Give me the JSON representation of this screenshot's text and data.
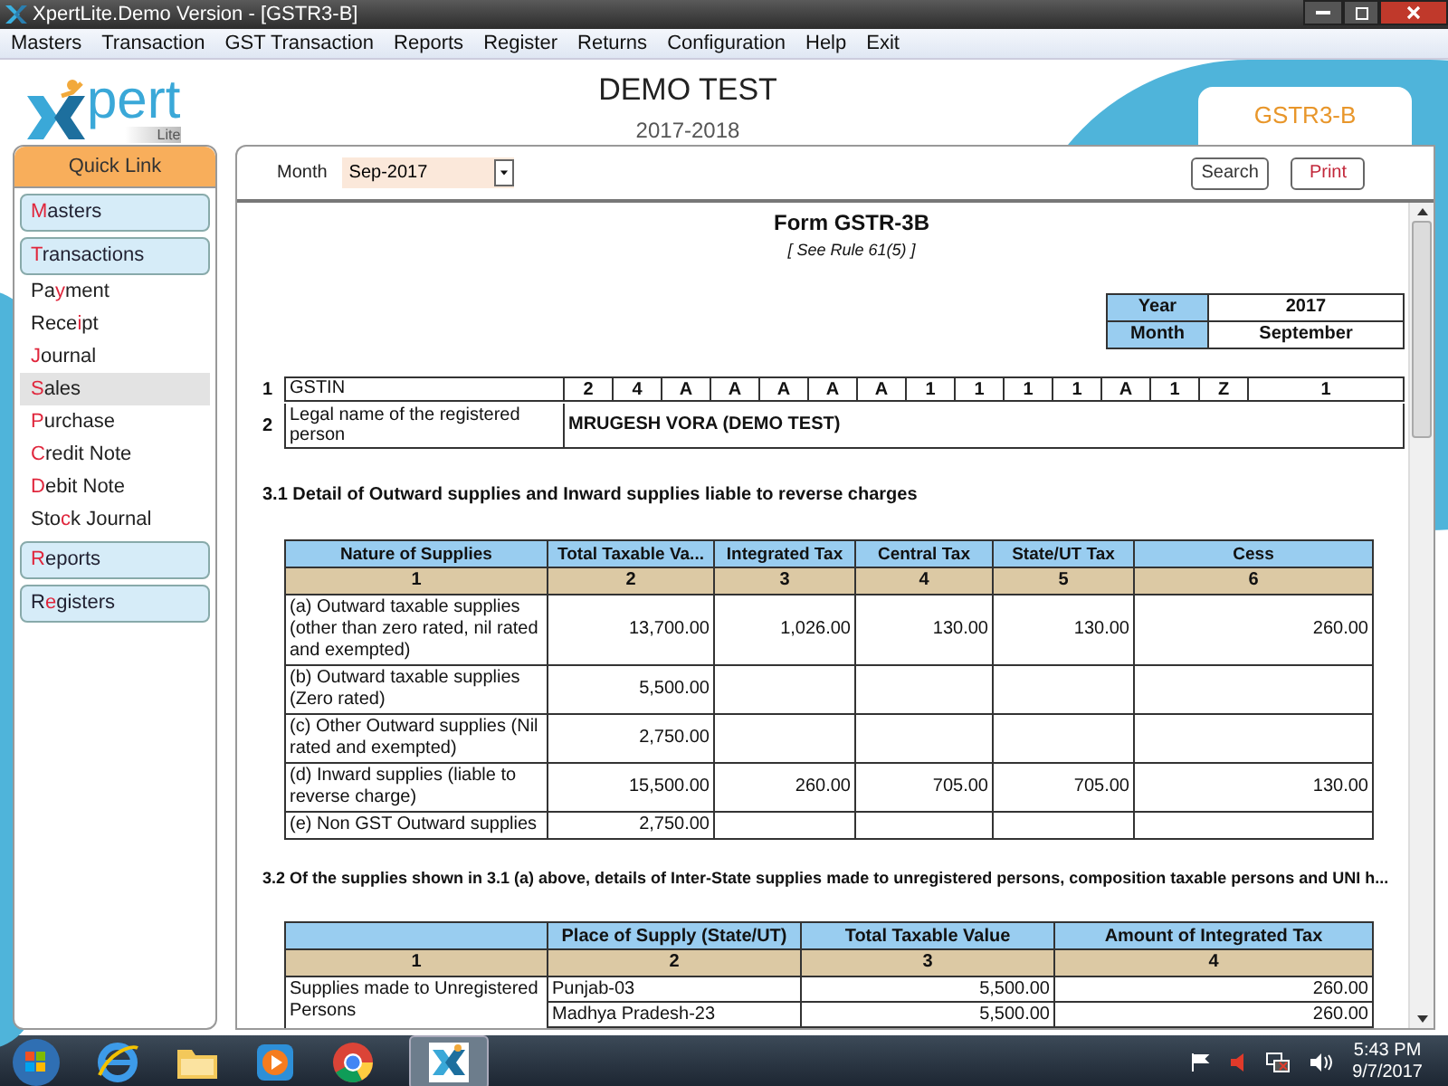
{
  "window": {
    "title": "XpertLite.Demo Version - [GSTR3-B]"
  },
  "menu": [
    "Masters",
    "Transaction",
    "GST Transaction",
    "Reports",
    "Register",
    "Returns",
    "Configuration",
    "Help",
    "Exit"
  ],
  "logo": {
    "wordmark": "pert",
    "tagline": "Lite"
  },
  "header": {
    "company": "DEMO TEST",
    "year": "2017-2018",
    "tab": "GSTR3-B"
  },
  "sidebar": {
    "title": "Quick Link",
    "items": [
      {
        "kind": "section",
        "key": "M",
        "after": "asters",
        "selected": false
      },
      {
        "kind": "section",
        "key": "T",
        "after": "ransactions",
        "selected": false
      },
      {
        "kind": "item",
        "before": "Pa",
        "key": "y",
        "after": "ment",
        "selected": false
      },
      {
        "kind": "item",
        "before": "Rece",
        "key": "i",
        "after": "pt",
        "selected": false
      },
      {
        "kind": "item",
        "key": "J",
        "after": "ournal",
        "selected": false
      },
      {
        "kind": "item",
        "key": "S",
        "after": "ales",
        "selected": true
      },
      {
        "kind": "item",
        "key": "P",
        "after": "urchase",
        "selected": false
      },
      {
        "kind": "item",
        "key": "C",
        "after": "redit Note",
        "selected": false
      },
      {
        "kind": "item",
        "key": "D",
        "after": "ebit Note",
        "selected": false
      },
      {
        "kind": "item",
        "before": "Sto",
        "key": "c",
        "after": "k Journal",
        "selected": false
      },
      {
        "kind": "section",
        "key": "R",
        "after": "eports",
        "selected": false
      },
      {
        "kind": "section",
        "before": "R",
        "key": "e",
        "after": "gisters",
        "selected": false
      }
    ]
  },
  "toolbar": {
    "month_label": "Month",
    "month_value": "Sep-2017",
    "buttons": [
      "Search",
      "Print"
    ]
  },
  "form": {
    "title": "Form GSTR-3B",
    "subtitle": "[ See Rule 61(5) ]",
    "period": [
      {
        "label": "Year",
        "value": "2017"
      },
      {
        "label": "Month",
        "value": "September"
      }
    ],
    "details": [
      {
        "number": "1",
        "label": "GSTIN",
        "cells": [
          "2",
          "4",
          "A",
          "A",
          "A",
          "A",
          "A",
          "1",
          "1",
          "1",
          "1",
          "A",
          "1",
          "Z",
          "1"
        ]
      },
      {
        "number": "2",
        "label": "Legal name of the registered person",
        "value": "MRUGESH VORA (DEMO TEST)"
      }
    ],
    "section_31": {
      "heading": "3.1 Detail of Outward supplies and Inward supplies liable to reverse charges",
      "columns": [
        "Nature of Supplies",
        "Total Taxable Va...",
        "Integrated Tax",
        "Central Tax",
        "State/UT Tax",
        "Cess"
      ],
      "column_numbers": [
        "1",
        "2",
        "3",
        "4",
        "5",
        "6"
      ],
      "rows": [
        [
          "(a) Outward taxable supplies (other than zero rated, nil rated and exempted)",
          "13,700.00",
          "1,026.00",
          "130.00",
          "130.00",
          "260.00"
        ],
        [
          "(b) Outward taxable supplies (Zero rated)",
          "5,500.00",
          "",
          "",
          "",
          ""
        ],
        [
          "(c) Other Outward supplies (Nil rated and exempted)",
          "2,750.00",
          "",
          "",
          "",
          ""
        ],
        [
          "(d) Inward supplies (liable to reverse charge)",
          "15,500.00",
          "260.00",
          "705.00",
          "705.00",
          "130.00"
        ],
        [
          "(e) Non GST Outward supplies",
          "2,750.00",
          "",
          "",
          "",
          ""
        ]
      ]
    },
    "section_32": {
      "heading": "3.2 Of the supplies shown in 3.1 (a) above, details of Inter-State supplies made to unregistered persons, composition taxable persons and UNI h...",
      "columns": [
        "",
        "Place of Supply (State/UT)",
        "Total Taxable Value",
        "Amount of Integrated Tax"
      ],
      "column_numbers": [
        "1",
        "2",
        "3",
        "4"
      ],
      "rows": [
        [
          "Supplies made to Unregistered Persons",
          "Punjab-03",
          "5,500.00",
          "260.00"
        ],
        [
          "",
          "Madhya Pradesh-23",
          "5,500.00",
          "260.00"
        ]
      ]
    }
  },
  "taskbar": {
    "time": "5:43 PM",
    "date": "9/7/2017"
  }
}
